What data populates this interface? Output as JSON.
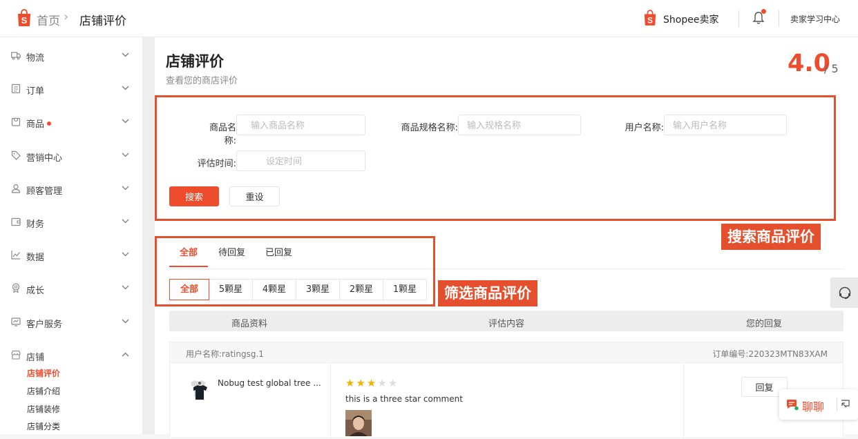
{
  "header": {
    "breadcrumb_home": "首页",
    "breadcrumb_sep": "›",
    "breadcrumb_current": "店铺评价",
    "brand": "Shopee卖家",
    "learning_center": "卖家学习中心"
  },
  "sidebar": {
    "items": [
      {
        "label": "物流",
        "icon": "truck-icon"
      },
      {
        "label": "订单",
        "icon": "clipboard-icon"
      },
      {
        "label": "商品",
        "icon": "bag-icon"
      },
      {
        "label": "营销中心",
        "icon": "tag-icon"
      },
      {
        "label": "顾客管理",
        "icon": "user-icon"
      },
      {
        "label": "财务",
        "icon": "wallet-icon"
      },
      {
        "label": "数据",
        "icon": "chart-icon"
      },
      {
        "label": "成长",
        "icon": "badge-icon"
      },
      {
        "label": "客户服务",
        "icon": "support-icon"
      },
      {
        "label": "店铺",
        "icon": "store-icon"
      }
    ],
    "sub_items": [
      "店铺评价",
      "店铺介绍",
      "店铺装修",
      "店铺分类"
    ]
  },
  "page": {
    "title": "店铺评价",
    "subtitle": "查看您的商店评价",
    "score": "4.0",
    "score_max": "/ 5"
  },
  "filters": {
    "product_name_label": "商品名称:",
    "product_name_placeholder": "输入商品名称",
    "variation_label": "商品规格名称:",
    "variation_placeholder": "输入规格名称",
    "username_label": "用户名称:",
    "username_placeholder": "输入用户名称",
    "time_label": "评估时间:",
    "time_placeholder": "设定时间",
    "search_button": "搜索",
    "reset_button": "重设"
  },
  "annotations": {
    "search_tag": "搜索商品评价",
    "filter_tag": "筛选商品评价"
  },
  "tabs": [
    "全部",
    "待回复",
    "已回复"
  ],
  "star_filters": [
    "全部",
    "5颗星",
    "4颗星",
    "3颗星",
    "2颗星",
    "1颗星"
  ],
  "table": {
    "headers": [
      "商品资料",
      "评估内容",
      "您的回复"
    ]
  },
  "review": {
    "user": "用户名称:ratingsg.1",
    "order": "订单编号:220323MTN83XAM",
    "product_name": "Nobug test global tree ...",
    "rating": 3,
    "rating_max": 5,
    "comment": "this is a three star comment",
    "reply_button": "回复"
  },
  "chat": {
    "label": "聊聊"
  },
  "colors": {
    "accent": "#ee4d2d",
    "annotation": "#e4502d",
    "star": "#f5b301"
  }
}
